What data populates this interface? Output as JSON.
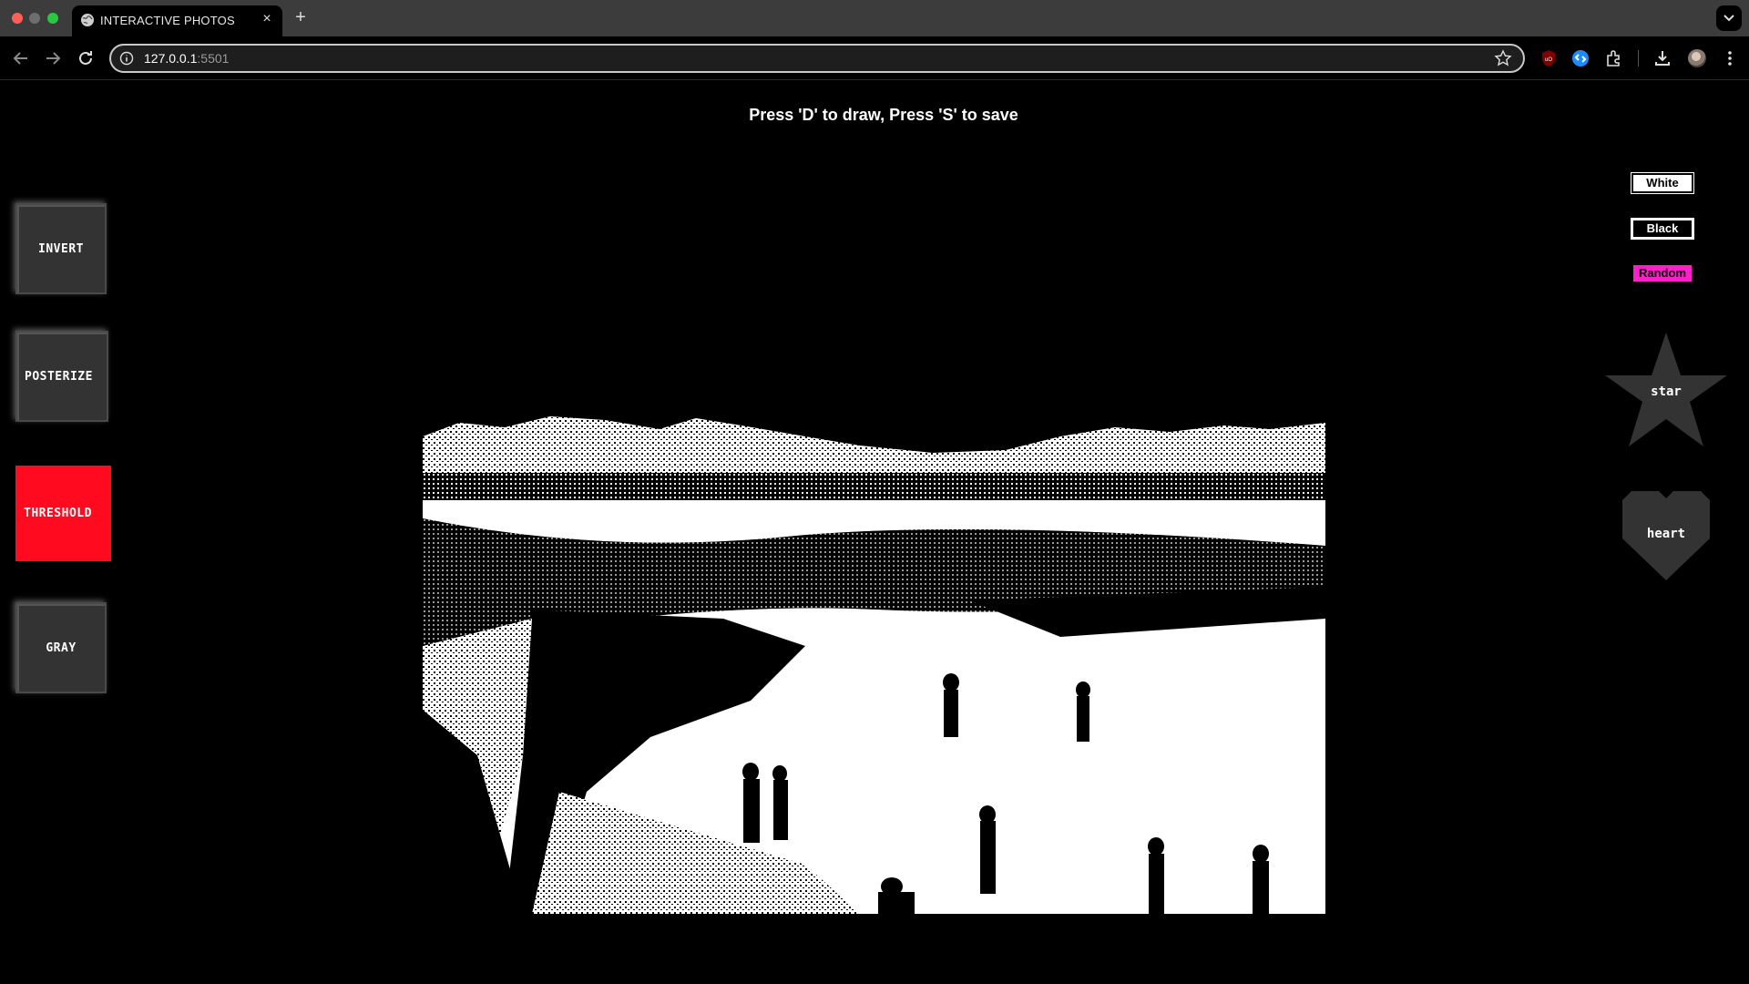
{
  "browser": {
    "tab_title": "INTERACTIVE PHOTOS",
    "tab_close": "×",
    "new_tab": "+",
    "url_host": "127.0.0.1",
    "url_port": ":5501"
  },
  "page": {
    "instructions": "Press 'D' to draw, Press 'S' to save"
  },
  "filters": {
    "invert": "INVERT",
    "posterize": "POSTERIZE",
    "threshold": "THRESHOLD",
    "gray": "GRAY",
    "active": "THRESHOLD",
    "active_color": "#ff0a1e"
  },
  "colors": {
    "white": "White",
    "black": "Black",
    "random": "Random",
    "random_bg": "#ff1fc8"
  },
  "shapes": {
    "star": "star",
    "heart": "heart"
  }
}
